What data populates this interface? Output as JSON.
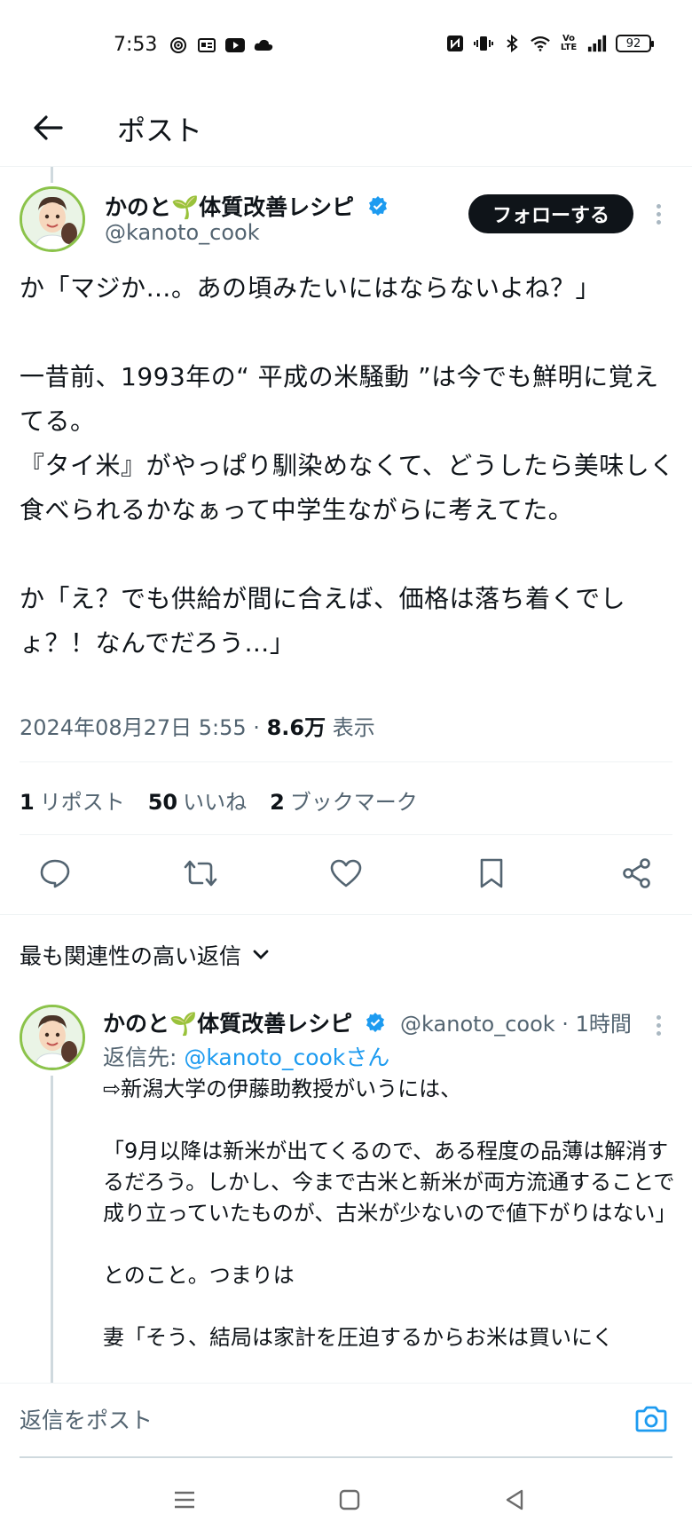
{
  "status_bar": {
    "time": "7:53",
    "battery": "92",
    "left_icons": [
      "target-icon",
      "news-icon",
      "youtube-icon",
      "cloud-icon"
    ],
    "right_icons": [
      "nfc-icon",
      "vibrate-icon",
      "bluetooth-icon",
      "wifi-icon",
      "volte-icon",
      "signal-icon"
    ]
  },
  "header": {
    "title": "ポスト"
  },
  "tweet": {
    "author_name": "かのと🌱体質改善レシピ",
    "author_handle": "@kanoto_cook",
    "follow_label": "フォローする",
    "body": "か「マジか…。あの頃みたいにはならないよね？」\n\n一昔前、1993年の“ 平成の米騒動 ”は今でも鮮明に覚えてる。\n『タイ米』がやっぱり馴染めなくて、どうしたら美味しく食べられるかなぁって中学生ながらに考えてた。\n\nか「え？でも供給が間に合えば、価格は落ち着くでしょ？！なんでだろう…」",
    "timestamp": "2024年08月27日 5:55 · ",
    "views_count": "8.6万",
    "views_label": " 表示",
    "reposts_count": "1",
    "reposts_label": "リポスト",
    "likes_count": "50",
    "likes_label": "いいね",
    "bookmarks_count": "2",
    "bookmarks_label": "ブックマーク"
  },
  "replies_sort": {
    "label": "最も関連性の高い返信"
  },
  "reply": {
    "author_name": "かのと🌱体質改善レシピ",
    "author_meta": "@kanoto_cook · 1時間",
    "reply_to_prefix": "返信先: ",
    "reply_to_handle": "@kanoto_cookさん",
    "body": "⇨新潟大学の伊藤助教授がいうには、\n\n「9月以降は新米が出てくるので、ある程度の品薄は解消するだろう。しかし、今まで古米と新米が両方流通することで成り立っていたものが、古米が少ないので値下がりはない」\n\nとのこと。つまりは\n\n妻「そう、結局は家計を圧迫するからお米は買いにく"
  },
  "composer": {
    "placeholder": "返信をポスト"
  },
  "colors": {
    "accent": "#1d9bf0",
    "text": "#0f1419",
    "secondary": "#536471",
    "divider": "#eff3f4",
    "avatar_ring": "#8bc34a"
  }
}
